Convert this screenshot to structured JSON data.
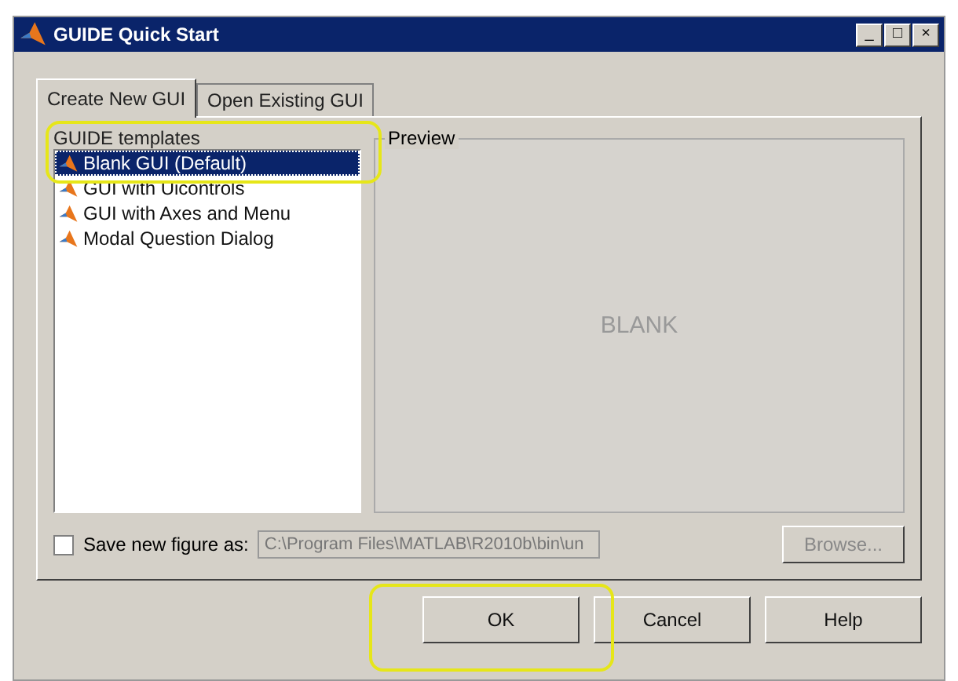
{
  "window": {
    "title": "GUIDE Quick Start",
    "controls": [
      "_",
      "□",
      "×"
    ]
  },
  "tabs": [
    {
      "label": "Create New GUI",
      "selected": true
    },
    {
      "label": "Open Existing GUI",
      "selected": false
    }
  ],
  "templates": {
    "title": "GUIDE templates",
    "items": [
      {
        "label": "Blank GUI (Default)",
        "selected": true
      },
      {
        "label": "GUI with Uicontrols",
        "selected": false
      },
      {
        "label": "GUI with Axes and Menu",
        "selected": false
      },
      {
        "label": "Modal Question Dialog",
        "selected": false
      }
    ]
  },
  "preview": {
    "title": "Preview",
    "text": "BLANK"
  },
  "save": {
    "label": "Save new figure as:",
    "checked": false,
    "value": "C:\\Program Files\\MATLAB\\R2010b\\bin\\un",
    "browse": "Browse...",
    "disabled": true
  },
  "buttons": [
    "OK",
    "Cancel",
    "Help"
  ]
}
